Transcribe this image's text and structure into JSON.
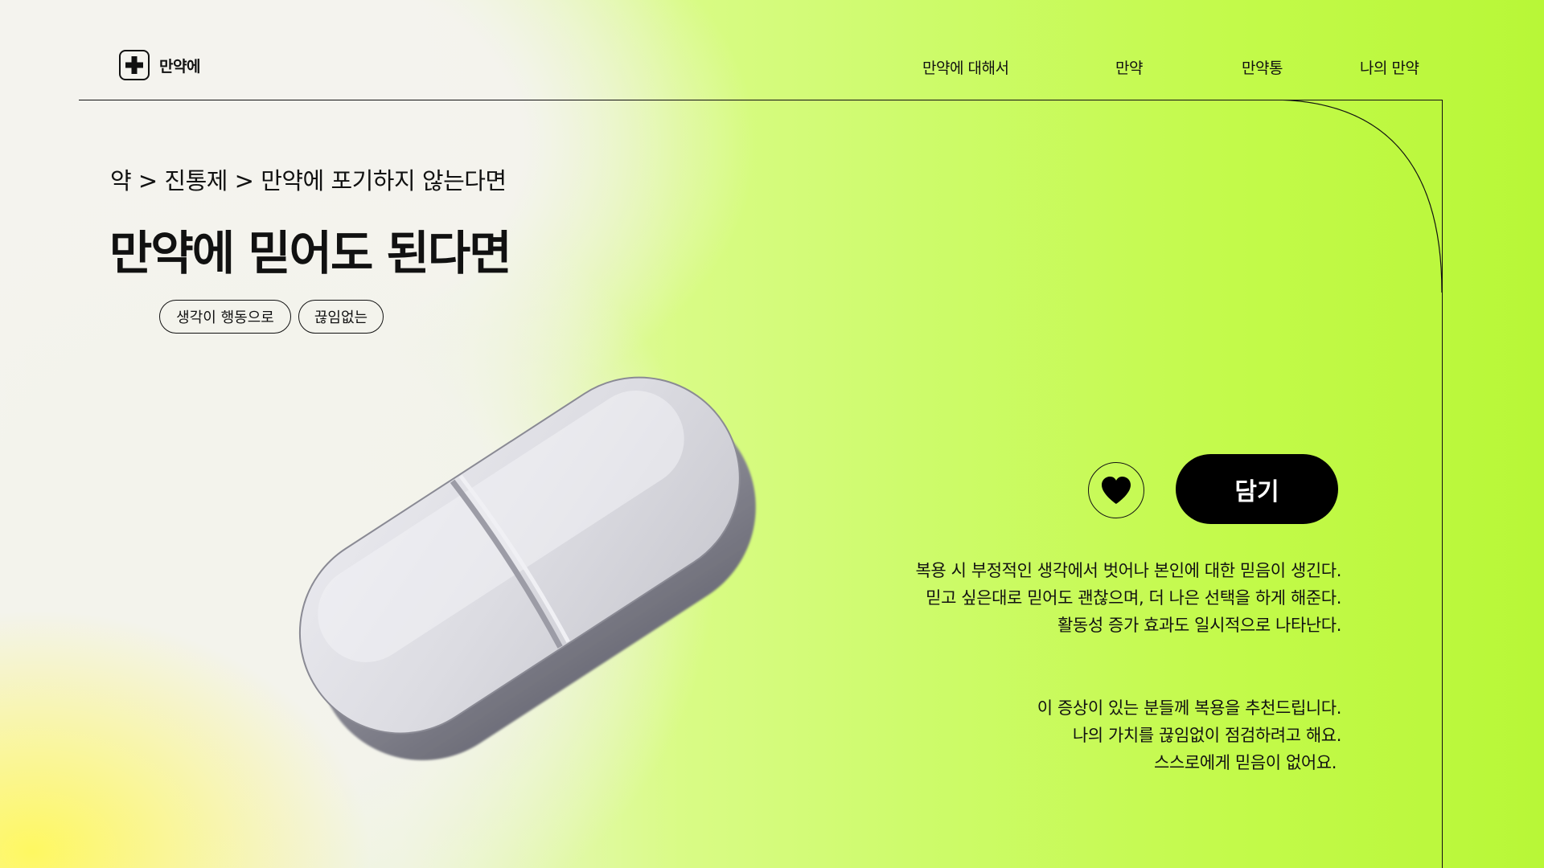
{
  "header": {
    "logo_text": "만약에",
    "nav": [
      "만약에 대해서",
      "만약",
      "만약통",
      "나의 만약"
    ]
  },
  "product": {
    "breadcrumb": "약 > 진통제 > 만약에 포기하지 않는다면",
    "title": "만약에 믿어도 된다면",
    "tags": [
      "생각이 행동으로",
      "끊임없는"
    ],
    "add_button": "담기",
    "description": [
      "복용 시 부정적인 생각에서 벗어나 본인에 대한 믿음이 생긴다.",
      "믿고 싶은대로 믿어도 괜찮으며, 더 나은 선택을 하게 해준다.",
      "활동성 증가 효과도 일시적으로 나타난다."
    ],
    "recommendation": [
      "이 증상이 있는 분들께 복용을 추천드립니다.",
      "나의 가치를 끊임없이 점검하려고 해요.",
      "스스로에게 믿음이 없어요."
    ]
  },
  "colors": {
    "accent": "#c3fa4a",
    "text": "#111111",
    "button": "#000000"
  },
  "icons": {
    "logo": "plus-icon",
    "wishlist": "heart-icon",
    "product_image": "pill-image"
  }
}
